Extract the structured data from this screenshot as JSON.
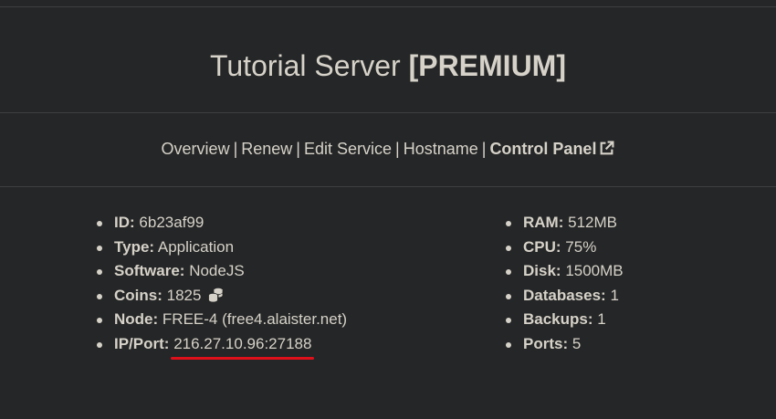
{
  "header": {
    "server_name": "Tutorial Server",
    "tier": "[PREMIUM]"
  },
  "nav": {
    "overview": "Overview",
    "renew": "Renew",
    "edit_service": "Edit Service",
    "hostname": "Hostname",
    "control_panel": "Control Panel",
    "separator": "|"
  },
  "details_left": [
    {
      "label": "ID:",
      "value": "6b23af99"
    },
    {
      "label": "Type:",
      "value": "Application"
    },
    {
      "label": "Software:",
      "value": "NodeJS"
    },
    {
      "label": "Coins:",
      "value": "1825"
    },
    {
      "label": "Node:",
      "value": "FREE-4 (free4.alaister.net)"
    },
    {
      "label": "IP/Port:",
      "value": "216.27.10.96:27188"
    }
  ],
  "details_right": [
    {
      "label": "RAM:",
      "value": "512MB"
    },
    {
      "label": "CPU:",
      "value": "75%"
    },
    {
      "label": "Disk:",
      "value": "1500MB"
    },
    {
      "label": "Databases:",
      "value": "1"
    },
    {
      "label": "Backups:",
      "value": "1"
    },
    {
      "label": "Ports:",
      "value": "5"
    }
  ],
  "icons": {
    "control_panel_icon": "external-link-icon",
    "coins_icon": "coins-icon"
  },
  "colors": {
    "background": "#252627",
    "text": "#d6d2c9",
    "highlight_underline": "#e0101a"
  }
}
